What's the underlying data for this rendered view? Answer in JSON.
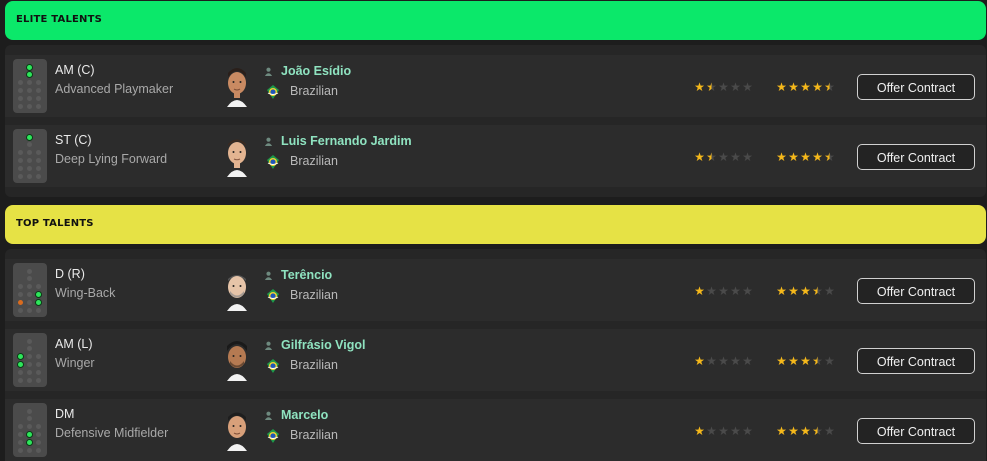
{
  "colors": {
    "elite_header": "#0be86a",
    "top_header": "#e6e245",
    "accent_name": "#8fe3c0",
    "star": "#f5b81b"
  },
  "sections": [
    {
      "title": "ELITE TALENTS",
      "players": [
        {
          "position": "AM (C)",
          "role": "Advanced Playmaker",
          "name": "João Esídio",
          "nationality": "Brazilian",
          "current_ability_stars": 1.5,
          "potential_ability_stars": 4.5,
          "action": "Offer Contract",
          "pitch_icon": "positions-pitch-icon"
        },
        {
          "position": "ST (C)",
          "role": "Deep Lying Forward",
          "name": "Luis Fernando Jardim",
          "nationality": "Brazilian",
          "current_ability_stars": 1.5,
          "potential_ability_stars": 4.5,
          "action": "Offer Contract",
          "pitch_icon": "positions-pitch-icon"
        }
      ]
    },
    {
      "title": "TOP TALENTS",
      "players": [
        {
          "position": "D (R)",
          "role": "Wing-Back",
          "name": "Terêncio",
          "nationality": "Brazilian",
          "current_ability_stars": 1,
          "potential_ability_stars": 3.5,
          "action": "Offer Contract",
          "pitch_icon": "positions-pitch-icon"
        },
        {
          "position": "AM (L)",
          "role": "Winger",
          "name": "Gilfrásio Vigol",
          "nationality": "Brazilian",
          "current_ability_stars": 1,
          "potential_ability_stars": 3.5,
          "action": "Offer Contract",
          "pitch_icon": "positions-pitch-icon"
        },
        {
          "position": "DM",
          "role": "Defensive Midfielder",
          "name": "Marcelo",
          "nationality": "Brazilian",
          "current_ability_stars": 1,
          "potential_ability_stars": 3.5,
          "action": "Offer Contract",
          "pitch_icon": "positions-pitch-icon"
        }
      ]
    }
  ]
}
